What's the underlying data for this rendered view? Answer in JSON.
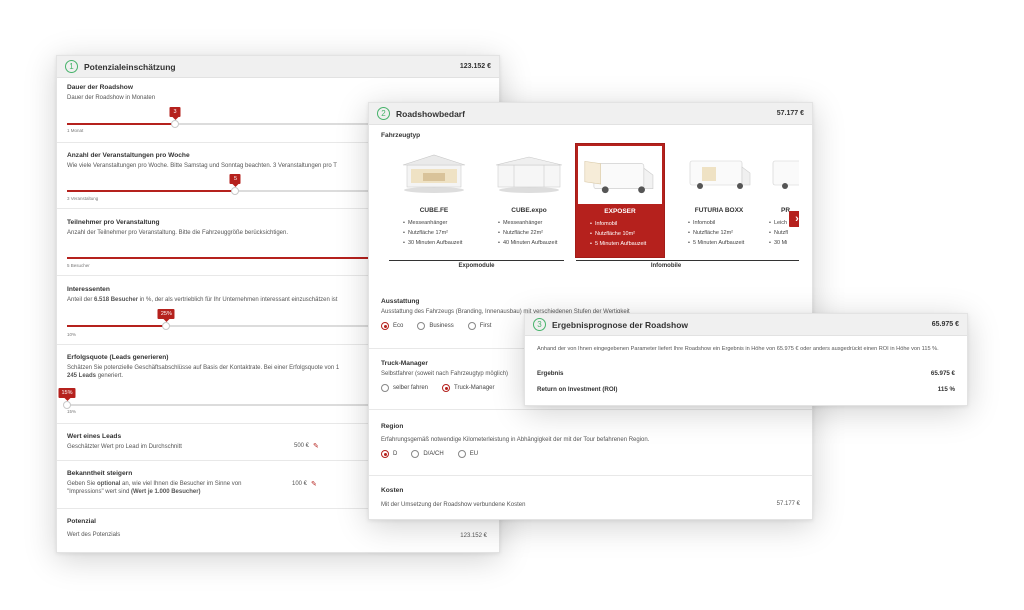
{
  "card1": {
    "number": "1",
    "title": "Potenzialeinschätzung",
    "total": "123.152 €",
    "dauer": {
      "title": "Dauer der Roadshow",
      "desc": "Dauer der Roadshow in Monaten",
      "bubble": "3",
      "tick": "1 Monat",
      "level": 0.25
    },
    "anzahl": {
      "title": "Anzahl der Veranstaltungen pro Woche",
      "desc": "Wie viele Veranstaltungen pro Woche. Bitte Samstag und Sonntag beachten. 3 Veranstaltungen pro T",
      "bubble": "5",
      "tick": "3 Veranstaltung",
      "level": 0.39
    },
    "teilnehmer": {
      "title": "Teilnehmer pro Veranstaltung",
      "desc": "Anzahl der Teilnehmer pro Veranstaltung. Bitte die Fahrzeuggröße berücksichtigen.",
      "tick": "5 Besucher",
      "level": 1.0
    },
    "interessenten": {
      "title": "Interessenten",
      "desc_pre": "Anteil der ",
      "desc_bold": "6.518 Besucher",
      "desc_post": " in %, der als vertrieblich für Ihr Unternehmen interessant einzuschätzen ist",
      "bubble": "25%",
      "tick": "10%",
      "level": 0.23
    },
    "erfolg": {
      "title": "Erfolgsquote (Leads generieren)",
      "desc": "Schätzen Sie potenzielle Geschäftsabschlüsse auf Basis der Kontaktrate. Bei einer Erfolgsquote von 1",
      "desc2_bold": "245 Leads",
      "desc2_post": " generiert.",
      "bubble": "15%",
      "tick": "15%",
      "level": 0.0
    },
    "wert": {
      "title": "Wert eines Leads",
      "desc": "Geschätzter Wert pro Lead im Durchschnitt",
      "value": "500 €"
    },
    "bekanntheit": {
      "title": "Bekanntheit steigern",
      "desc_pre": "Geben Sie ",
      "desc_bold": "optional",
      "desc_mid": " an, wie viel Ihnen die Besucher im Sinne von",
      "desc_line2": "\"Impressions\" wert sind ",
      "desc_bold2": "(Wert je 1.000 Besucher)",
      "value": "100 €"
    },
    "potenzial": {
      "title": "Potenzial",
      "desc": "Wert des Potenzials",
      "value": "123.152 €"
    }
  },
  "card2": {
    "number": "2",
    "title": "Roadshowbedarf",
    "total": "57.177 €",
    "fahrzeugtyp_label": "Fahrzeugtyp",
    "vehicles": [
      {
        "name": "CUBE.FE",
        "features": [
          "Messeanhänger",
          "Nutzfläche 17m²",
          "30 Minuten Aufbauzeit"
        ],
        "selected": false
      },
      {
        "name": "CUBE.expo",
        "features": [
          "Messeanhänger",
          "Nutzfläche 22m²",
          "40 Minuten Aufbauzeit"
        ],
        "selected": false
      },
      {
        "name": "EXPOSER",
        "features": [
          "Infomobil",
          "Nutzfläche 10m²",
          "5 Minuten Aufbauzeit"
        ],
        "selected": true
      },
      {
        "name": "FUTURIA BOXX",
        "features": [
          "Infomobil",
          "Nutzfläche 12m²",
          "5 Minuten Aufbauzeit"
        ],
        "selected": false
      },
      {
        "name": "PR",
        "features": [
          "Leich",
          "Nutzfl",
          "30 Mi"
        ],
        "selected": false
      }
    ],
    "group_expo": "Expomodule",
    "group_info": "Infomobile",
    "ausstattung": {
      "title": "Ausstattung",
      "desc": "Ausstattung des Fahrzeugs (Branding, Innenausbau) mit verschiedenen Stufen der Wertigkeit",
      "options": [
        "Eco",
        "Business",
        "First"
      ],
      "selected": "Eco"
    },
    "truck": {
      "title": "Truck-Manager",
      "desc": "Selbstfahrer (soweit nach Fahrzeugtyp möglich)",
      "options": [
        "selber fahren",
        "Truck-Manager"
      ],
      "selected": "Truck-Manager"
    },
    "region": {
      "title": "Region",
      "desc": "Erfahrungsgemäß notwendige Kilometerleistung in Abhängigkeit der mit der Tour befahrenen Region.",
      "options": [
        "D",
        "D/A/CH",
        "EU"
      ],
      "selected": "D"
    },
    "kosten": {
      "title": "Kosten",
      "desc": "Mit der Umsetzung der Roadshow verbundene Kosten",
      "value": "57.177 €"
    }
  },
  "card3": {
    "number": "3",
    "title": "Ergebnisprognose der Roadshow",
    "total": "65.975 €",
    "text": "Anhand der von Ihnen eingegebenen Parameter liefert Ihre Roadshow ein Ergebnis in Höhe von 65.975 € oder anders ausgedrückt einen ROI in Höhe von 115 %.",
    "ergebnis_label": "Ergebnis",
    "ergebnis_value": "65.975 €",
    "roi_label": "Return on Investment (ROI)",
    "roi_value": "115 %"
  },
  "colors": {
    "accent": "#b5211d",
    "step_circle": "#47b36b"
  }
}
